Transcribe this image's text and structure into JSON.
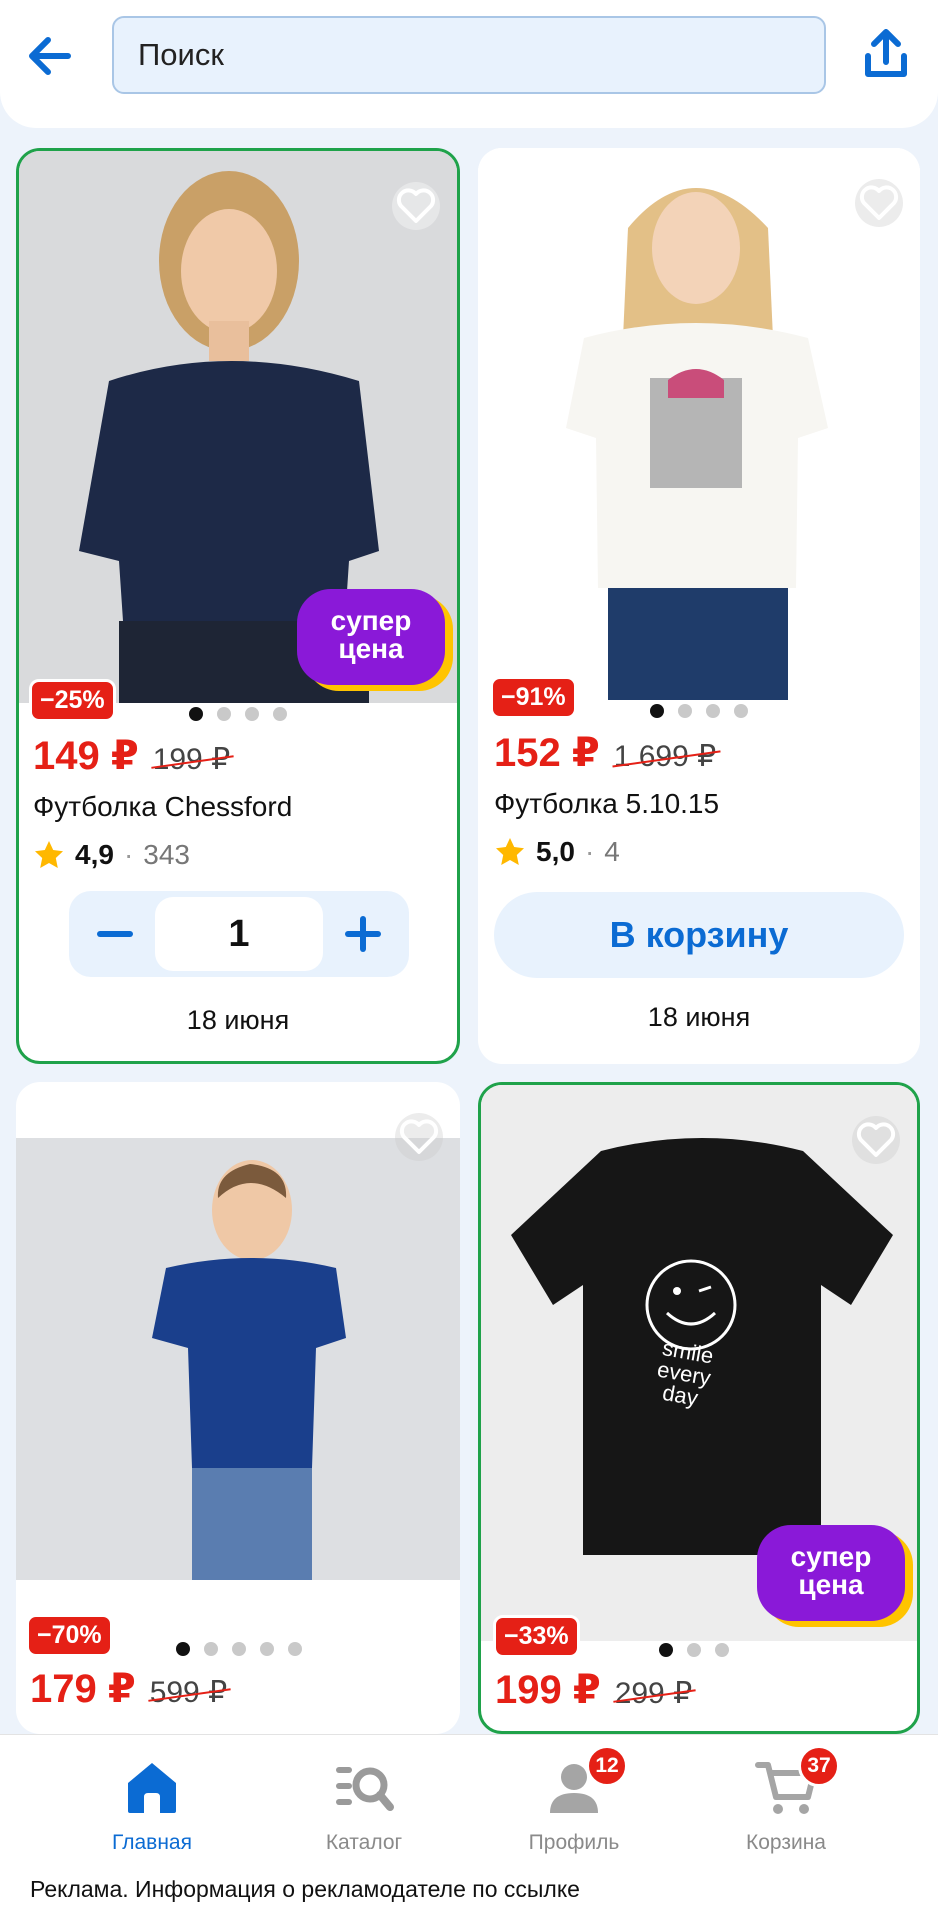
{
  "search": {
    "placeholder": "Поиск"
  },
  "colors": {
    "accent": "#0b6bd3",
    "price_red": "#e52016",
    "selected_border": "#1fa24a",
    "super_badge_purple": "#8a19d8",
    "super_badge_yellow": "#ffc400"
  },
  "icons": {
    "back": "arrow-left-icon",
    "share": "share-icon",
    "favorite": "heart-icon",
    "rating": "star-icon"
  },
  "products": [
    {
      "discount": "−25%",
      "price": "149 ₽",
      "old_price": "199 ₽",
      "title": "Футболка Chessford",
      "rating": "4,9",
      "sep": "·",
      "reviews": "343",
      "quantity": "1",
      "delivery": "18 июня",
      "badge": "супер цена",
      "selected": true,
      "image_dots": 4,
      "active_dot": 1
    },
    {
      "discount": "−91%",
      "price": "152 ₽",
      "old_price": "1 699 ₽",
      "title": "Футболка 5.10.15",
      "rating": "5,0",
      "sep": "·",
      "reviews": "4",
      "cart_label": "В корзину",
      "delivery": "18 июня",
      "selected": false,
      "image_dots": 4,
      "active_dot": 1
    },
    {
      "discount": "−70%",
      "price": "179 ₽",
      "old_price": "599 ₽",
      "selected": false,
      "image_dots": 5,
      "active_dot": 1
    },
    {
      "discount": "−33%",
      "price": "199 ₽",
      "old_price": "299 ₽",
      "badge": "супер цена",
      "print_text": "smile every day",
      "selected": true,
      "image_dots": 3,
      "active_dot": 1
    }
  ],
  "nav": {
    "items": [
      {
        "label": "Главная",
        "icon": "home-icon",
        "active": true
      },
      {
        "label": "Каталог",
        "icon": "catalog-search-icon",
        "active": false
      },
      {
        "label": "Профиль",
        "icon": "profile-icon",
        "badge": "12",
        "active": false
      },
      {
        "label": "Корзина",
        "icon": "cart-icon",
        "badge": "37",
        "active": false
      }
    ]
  },
  "footer": {
    "ad_note": "Реклама. Информация о рекламодателе по ссылке"
  }
}
